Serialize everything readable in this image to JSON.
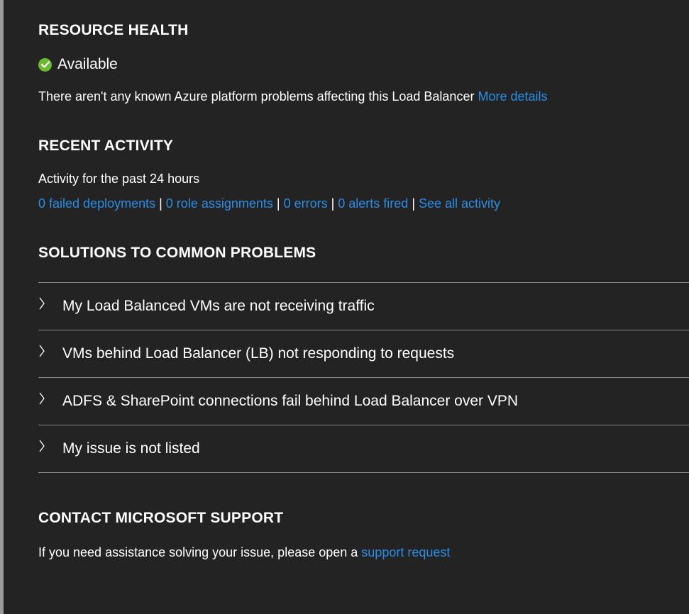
{
  "resource_health": {
    "heading": "RESOURCE HEALTH",
    "status": "Available",
    "status_color": "#6cbb2f",
    "description": "There aren't any known Azure platform problems affecting this Load Balancer",
    "more_details_link": "More details"
  },
  "recent_activity": {
    "heading": "RECENT ACTIVITY",
    "subtitle": "Activity for the past 24 hours",
    "links": [
      "0 failed deployments",
      "0 role assignments",
      "0 errors",
      "0 alerts fired",
      "See all activity"
    ],
    "separator": "|"
  },
  "solutions": {
    "heading": "SOLUTIONS TO COMMON PROBLEMS",
    "items": [
      {
        "label": "My Load Balanced VMs are not receiving traffic",
        "icon": "chevron-right-icon"
      },
      {
        "label": "VMs behind Load Balancer (LB) not responding to requests",
        "icon": "chevron-right-icon"
      },
      {
        "label": "ADFS & SharePoint connections fail behind Load Balancer over VPN",
        "icon": "chevron-right-icon"
      },
      {
        "label": "My issue is not listed",
        "icon": "chevron-right-icon"
      }
    ]
  },
  "contact_support": {
    "heading": "CONTACT MICROSOFT SUPPORT",
    "description": "If you need assistance solving your issue, please open a",
    "support_link": "support request"
  },
  "colors": {
    "background": "#232323",
    "link": "#2a8ee6",
    "divider": "#8a8a8a"
  }
}
